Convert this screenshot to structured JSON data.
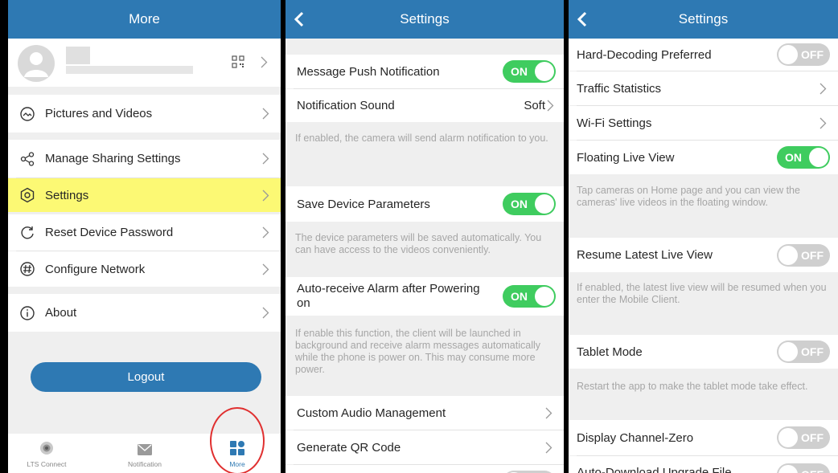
{
  "more_panel": {
    "title": "More",
    "menu": [
      {
        "label": "Pictures and Videos",
        "icon": "pictures-icon"
      },
      {
        "label": "Manage Sharing Settings",
        "icon": "share-icon"
      },
      {
        "label": "Settings",
        "icon": "settings-icon",
        "highlighted": true
      },
      {
        "label": "Reset Device Password",
        "icon": "reset-icon"
      },
      {
        "label": "Configure Network",
        "icon": "network-icon"
      },
      {
        "label": "About",
        "icon": "info-icon"
      }
    ],
    "logout_label": "Logout",
    "tabs": [
      {
        "label": "LTS Connect",
        "icon": "lts-connect-icon"
      },
      {
        "label": "Notification",
        "icon": "mail-icon"
      },
      {
        "label": "More",
        "icon": "more-grid-icon",
        "active": true
      }
    ]
  },
  "settings_panel_1": {
    "title": "Settings",
    "items": [
      {
        "label": "Message Push Notification",
        "toggle": "ON"
      },
      {
        "label": "Notification Sound",
        "value": "Soft"
      },
      {
        "label": "Save Device Parameters",
        "toggle": "ON"
      },
      {
        "label": "Auto-receive Alarm after Powering on",
        "toggle": "ON"
      },
      {
        "label": "Custom Audio Management"
      },
      {
        "label": "Generate QR Code"
      }
    ],
    "descriptions": [
      "If enabled, the camera will send alarm notification to you.",
      "The device parameters will be saved automatically. You can have access to the videos conveniently.",
      "If enable this function, the client will be launched in background and receive alarm messages automatically while the phone is power on. This may consume more power."
    ]
  },
  "settings_panel_2": {
    "title": "Settings",
    "items": [
      {
        "label": "Hard-Decoding Preferred",
        "toggle": "OFF"
      },
      {
        "label": "Traffic Statistics"
      },
      {
        "label": "Wi-Fi Settings"
      },
      {
        "label": "Floating Live View",
        "toggle": "ON"
      },
      {
        "label": "Resume Latest Live View",
        "toggle": "OFF"
      },
      {
        "label": "Tablet Mode",
        "toggle": "OFF"
      },
      {
        "label": "Display Channel-Zero",
        "toggle": "OFF"
      },
      {
        "label": "Auto-Download Upgrade File",
        "toggle": "OFF"
      }
    ],
    "descriptions": [
      "Tap cameras on Home page and you can view the cameras' live videos in the floating window.",
      "If enabled, the latest live view will be resumed when you enter the Mobile Client.",
      "Restart the app to make the tablet mode take effect."
    ]
  },
  "colors": {
    "header_blue": "#2e79b3",
    "toggle_on": "#3fcc5f",
    "toggle_off": "#cfcfcf",
    "highlight_yellow": "#fcf974",
    "annotation_red": "#e03030"
  }
}
